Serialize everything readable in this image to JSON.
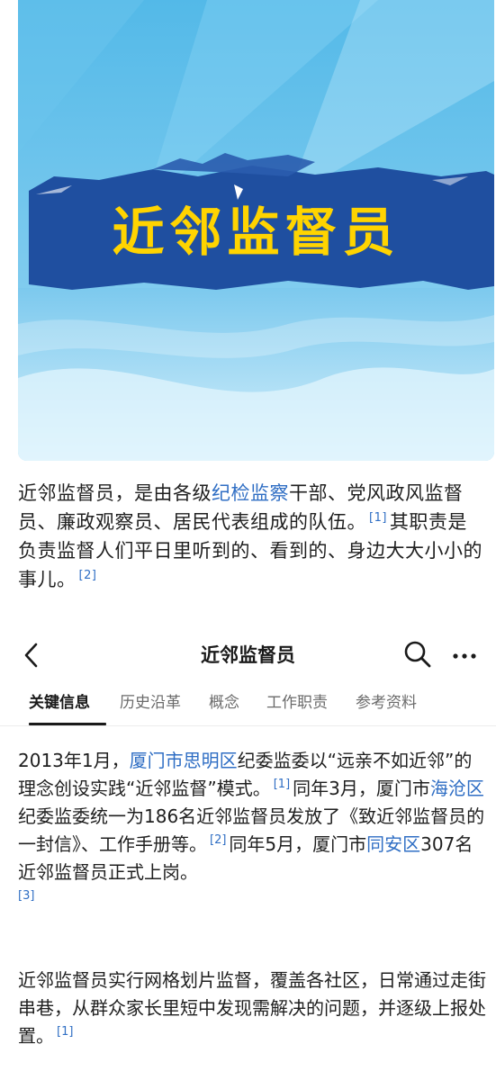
{
  "hero": {
    "title": "近邻监督员"
  },
  "intro": {
    "p1": "近邻监督员，是由各级",
    "link1": "纪检监察",
    "p2": "干部、党风政风监督员、廉政观察员、居民代表组成的队伍。",
    "ref1": "[1]",
    "p3": "其职责是负责监督人们平日里听到的、看到的、身边大大小小的事儿。",
    "ref2": "[2]"
  },
  "topbar": {
    "title": "近邻监督员",
    "back_icon": "chevron-left-icon",
    "search_icon": "search-icon",
    "more_icon": "more-horizontal-icon"
  },
  "tabs": [
    {
      "label": "关键信息",
      "active": true
    },
    {
      "label": "历史沿革",
      "active": false
    },
    {
      "label": "概念",
      "active": false
    },
    {
      "label": "工作职责",
      "active": false
    },
    {
      "label": "参考资料",
      "active": false
    }
  ],
  "para1": {
    "t1": "2013年1月，",
    "link1": "厦门市思明区",
    "t2": "纪委监委以“远亲不如近邻”的理念创设实践“近邻监督”模式。",
    "ref1": "[1]",
    "t3": "同年3月，厦门市",
    "link2": "海沧区",
    "t4": "纪委监委统一为186名近邻监督员发放了《致近邻监督员的一封信》、工作手册等。",
    "ref2": "[2]",
    "t5": "同年5月，厦门市",
    "link3": "同安区",
    "t6": "307名近邻监督员正式上岗。",
    "ref3": "[3]"
  },
  "para2": {
    "t1": "近邻监督员实行网格划片监督，覆盖各社区，日常通过走街串巷，从群众家长里短中发现需解决的问题，并逐级上报处置。",
    "ref1": "[1]"
  },
  "colors": {
    "link": "#2f6ec4",
    "hero_band": "#1f4fa0",
    "hero_title": "#ffd400"
  }
}
